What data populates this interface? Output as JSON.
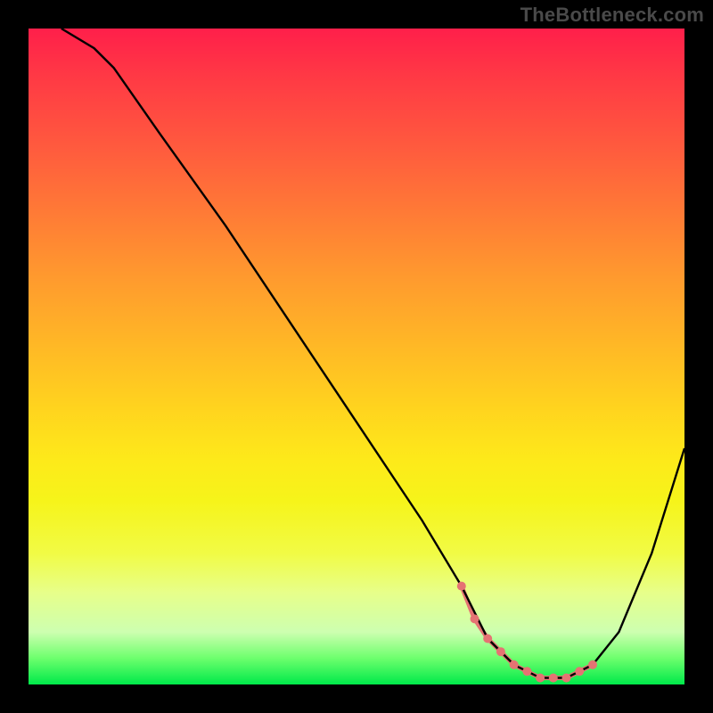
{
  "attribution": "TheBottleneck.com",
  "chart_data": {
    "type": "line",
    "title": "",
    "xlabel": "",
    "ylabel": "",
    "xlim": [
      0,
      100
    ],
    "ylim": [
      0,
      100
    ],
    "grid": false,
    "legend": false,
    "series": [
      {
        "name": "curve",
        "color": "#000000",
        "x": [
          5,
          10,
          13,
          20,
          30,
          40,
          50,
          60,
          66,
          70,
          74,
          78,
          82,
          86,
          90,
          95,
          100
        ],
        "values": [
          100,
          97,
          94,
          84,
          70,
          55,
          40,
          25,
          15,
          7,
          3,
          1,
          1,
          3,
          8,
          20,
          36
        ]
      }
    ],
    "markers": {
      "name": "highlight-dots",
      "color": "#e57373",
      "radius": 5,
      "x": [
        66,
        68,
        70,
        72,
        74,
        76,
        78,
        80,
        82,
        84,
        86
      ],
      "values": [
        15,
        10,
        7,
        5,
        3,
        2,
        1,
        1,
        1,
        2,
        3
      ]
    },
    "highlight_segment": {
      "color": "#e57373",
      "width": 5,
      "x": [
        66,
        68,
        70,
        72,
        74,
        76,
        78,
        80,
        82,
        84,
        86
      ],
      "values": [
        15,
        10,
        7,
        5,
        3,
        2,
        1,
        1,
        1,
        2,
        3
      ]
    },
    "gradient_stops": [
      {
        "pct": 0,
        "color": "#ff1f4a"
      },
      {
        "pct": 7,
        "color": "#ff3845"
      },
      {
        "pct": 18,
        "color": "#ff5a3e"
      },
      {
        "pct": 28,
        "color": "#ff7a36"
      },
      {
        "pct": 38,
        "color": "#ff9a2e"
      },
      {
        "pct": 48,
        "color": "#ffb726"
      },
      {
        "pct": 58,
        "color": "#ffd41e"
      },
      {
        "pct": 66,
        "color": "#fdea1a"
      },
      {
        "pct": 72,
        "color": "#f6f41a"
      },
      {
        "pct": 80,
        "color": "#f1fb45"
      },
      {
        "pct": 86,
        "color": "#e7ff8a"
      },
      {
        "pct": 92,
        "color": "#cdffb0"
      },
      {
        "pct": 96,
        "color": "#6dff6d"
      },
      {
        "pct": 100,
        "color": "#00e94a"
      }
    ]
  }
}
